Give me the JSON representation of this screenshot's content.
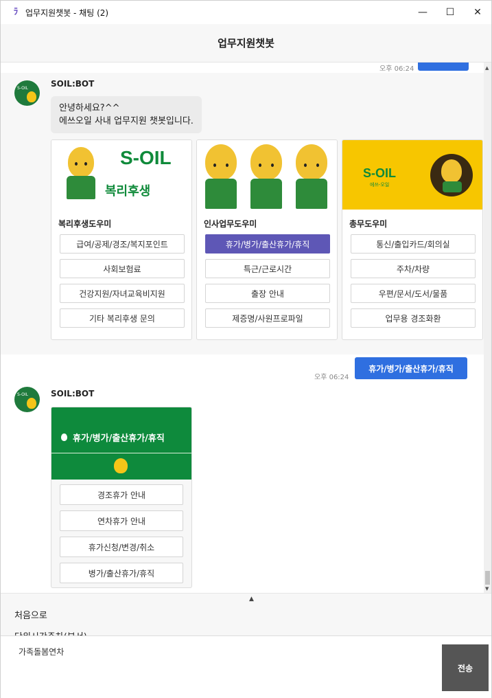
{
  "window": {
    "title": "업무지원챗봇 - 채팅 (2)",
    "minimize": "—",
    "maximize": "☐",
    "close": "✕"
  },
  "header": {
    "title": "업무지원챗봇"
  },
  "messages": {
    "top_time": "오후 06:24",
    "bot_name": "SOIL:BOT",
    "greeting_line1": "안녕하세요?^^",
    "greeting_line2": "에쓰오일 사내 업무지원 챗봇입니다.",
    "cards": [
      {
        "title": "복리후생도우미",
        "image_logo": "S-OIL",
        "image_caption": "복리후생",
        "buttons": [
          "급여/공제/경조/복지포인트",
          "사회보험료",
          "건강지원/자녀교육비지원",
          "기타 복리후생 문의"
        ]
      },
      {
        "title": "인사업무도우미",
        "buttons": [
          "휴가/병가/출산휴가/휴직",
          "특근/근로시간",
          "출장 안내",
          "제증명/사원프로파일"
        ],
        "active_index": 0
      },
      {
        "title": "총무도우미",
        "image_logo": "S-OIL",
        "image_sub": "에쓰-오일",
        "buttons": [
          "통신/출입카드/회의실",
          "주차/차량",
          "우편/문서/도서/물품",
          "업무용 경조화환"
        ]
      }
    ],
    "user_time": "오후 06:24",
    "user_message": "휴가/병가/출산휴가/휴직",
    "bot_name2": "SOIL:BOT",
    "menu_title": "휴가/병가/출산휴가/휴직",
    "menu_buttons": [
      "경조휴가 안내",
      "연차휴가 안내",
      "휴가신청/변경/취소",
      "병가/출산휴가/휴직"
    ]
  },
  "suggestions": {
    "items": [
      "처음으로",
      "단위시간주차(부서)"
    ]
  },
  "input": {
    "value": "가족돌봄연차",
    "send_label": "전송"
  },
  "colors": {
    "accent_purple": "#5e57b6",
    "user_bubble": "#2f6fe0",
    "menu_green": "#0e8a3c",
    "send_button": "#555555"
  }
}
